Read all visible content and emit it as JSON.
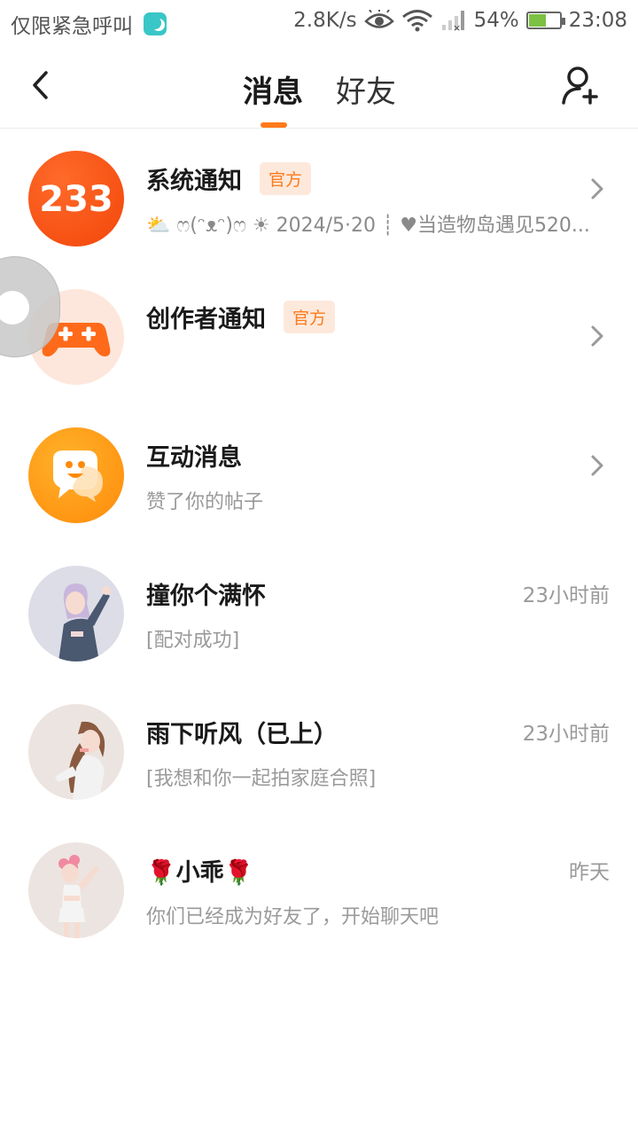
{
  "status_bar": {
    "left_text": "仅限紧急呼叫",
    "net_speed": "2.8K/s",
    "battery": "54%",
    "battery_level": 0.54,
    "time": "23:08"
  },
  "header": {
    "tabs": [
      {
        "label": "消息",
        "active": true
      },
      {
        "label": "好友",
        "active": false
      }
    ],
    "accent": "#ff7a1a",
    "icons": {
      "back": "chevron-left-icon",
      "add_friend": "add-user-icon"
    }
  },
  "messages": [
    {
      "name": "系统通知",
      "badge": "官方",
      "subtitle": "⛅ ෆ(ᵔᴥᵔ)ෆ ☀ 2024/5·20 ┊ ♥当造物岛遇见520...",
      "time": "",
      "avatar": "233",
      "type": "system"
    },
    {
      "name": "创作者通知",
      "badge": "官方",
      "subtitle": "",
      "time": "",
      "avatar": "gamepad-icon",
      "type": "creator"
    },
    {
      "name": "互动消息",
      "badge": "",
      "subtitle": "赞了你的帖子",
      "time": "",
      "avatar": "chat-smile-icon",
      "type": "interaction"
    },
    {
      "name": "撞你个满怀",
      "badge": "",
      "subtitle": "[配对成功]",
      "time": "23小时前",
      "avatar": "user-avatar",
      "type": "friend"
    },
    {
      "name": "雨下听风（已上）",
      "badge": "",
      "subtitle": "[我想和你一起拍家庭合照]",
      "time": "23小时前",
      "avatar": "user-avatar",
      "type": "friend"
    },
    {
      "name": "🌹小乖🌹",
      "badge": "",
      "subtitle": "你们已经成为好友了，开始聊天吧",
      "time": "昨天",
      "avatar": "user-avatar",
      "type": "friend"
    }
  ]
}
